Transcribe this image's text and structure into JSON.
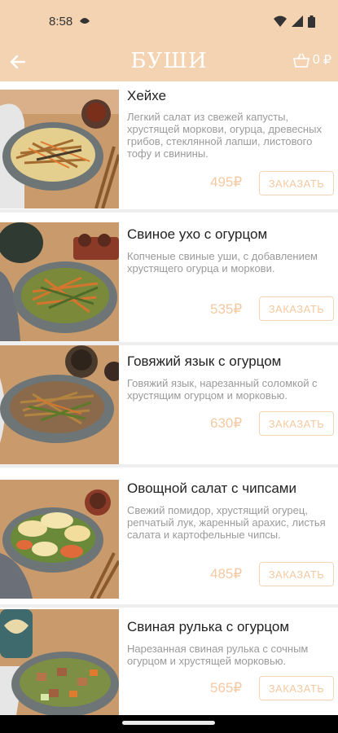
{
  "status": {
    "time": "8:58"
  },
  "appbar": {
    "title": "БУШИ",
    "cart_count": "0",
    "currency": "₽"
  },
  "colors": {
    "accent": "#f4d3b3",
    "price": "#f4c9a1"
  },
  "icons": [
    "back-arrow-icon",
    "basket-icon",
    "wifi-icon",
    "signal-icon",
    "battery-icon"
  ],
  "items": [
    {
      "name": "Хейхе",
      "desc": "Легкий салат из свежей капусты, хрустящей моркови, огурца, древесных грибов, стеклянной лапши, листового тофу и свинины.",
      "price": "495₽",
      "order": "ЗАКАЗАТЬ"
    },
    {
      "name": "Свиное ухо с огурцом",
      "desc": "Копченые свиные уши, с добавлением хрустящего огурца и моркови.",
      "price": "535₽",
      "order": "ЗАКАЗАТЬ"
    },
    {
      "name": "Говяжий язык с огурцом",
      "desc": "Говяжий язык, нарезанный соломкой с хрустящим огурцом и морковью.",
      "price": "630₽",
      "order": "ЗАКАЗАТЬ"
    },
    {
      "name": "Овощной салат с чипсами",
      "desc": "Свежий помидор, хрустящий огурец, репчатый лук, жаренный арахис, листья салата и картофельные чипсы.",
      "price": "485₽",
      "order": "ЗАКАЗАТЬ"
    },
    {
      "name": "Свиная рулька с огурцом",
      "desc": "Нарезанная свиная рулька с сочным огурцом и хрустящей морковью.",
      "price": "565₽",
      "order": "ЗАКАЗАТЬ"
    }
  ]
}
